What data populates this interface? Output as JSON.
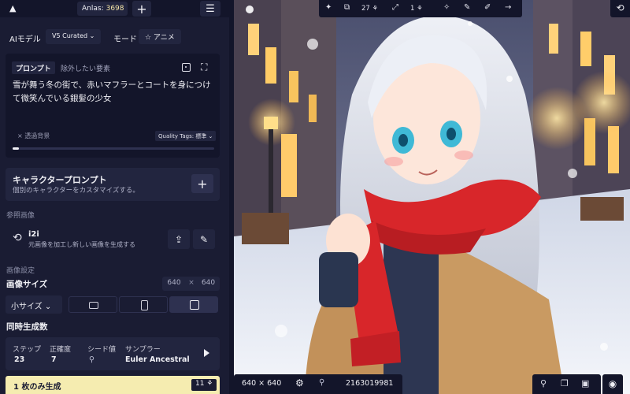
{
  "header": {
    "anlas_label": "Anlas:",
    "anlas_value": "3698",
    "plus_glyph": "+",
    "menu_glyph": "☰",
    "logo_glyph": "▲"
  },
  "model": {
    "label": "AIモデル",
    "value": "V5 Curated ⌄",
    "mode_label": "モード",
    "mode_value": "☆ アニメ"
  },
  "prompt": {
    "tab_prompt": "プロンプト",
    "tab_negative": "除外したい要素",
    "text": "雪が舞う冬の街で、赤いマフラーとコートを身につけて微笑んでいる銀髪の少女",
    "tag_suggestion": "× 透過背景",
    "quality_tags": "Quality Tags: 標準 ⌄",
    "expand_glyph": "⛶",
    "progress": 0.03
  },
  "character": {
    "title": "キャラクタープロンプト",
    "description": "個別のキャラクターをカスタマイズする。",
    "add_glyph": "+"
  },
  "reference": {
    "section_label": "参照画像",
    "i2i_title": "i2i",
    "i2i_description": "元画像を加工し新しい画像を生成する",
    "i2i_glyph": "⟲",
    "upload_glyph": "⇪",
    "edit_glyph": "✎"
  },
  "image_settings": {
    "section_label": "画像設定",
    "size_label": "画像サイズ",
    "width": "640",
    "height": "640",
    "times_glyph": "×",
    "size_preset": "小サイズ ⌄",
    "selected_shape": "square"
  },
  "batch": {
    "label": "同時生成数"
  },
  "params": {
    "steps_label": "ステップ",
    "steps_value": "23",
    "guidance_label": "正確度",
    "guidance_value": "7",
    "seed_label": "シード値",
    "seed_icon": "⚲",
    "sampler_label": "サンプラー",
    "sampler_value": "Euler Ancestral"
  },
  "generate": {
    "label": "1 枚のみ生成",
    "cost": "11 ⚘"
  },
  "toolbar": {
    "enhance": "✦",
    "variations": "⧉",
    "batch_count": "27 ⚘",
    "upscale": "⤢",
    "upscale_count": "1 ⚘",
    "magic": "✧",
    "paint": "✎",
    "director": "✐",
    "next": "→",
    "history": "⟲"
  },
  "image_info": {
    "size": "640 × 640",
    "gear": "⚙",
    "seed_icon": "⚲",
    "seed": "2163019981"
  },
  "image_actions": {
    "pin": "⚲",
    "copy": "❐",
    "save": "▣",
    "palette": "◉"
  },
  "colors": {
    "panel": "#1a1c33",
    "surface": "#22253f",
    "accent": "#f5ecb0",
    "background": "#13152a"
  }
}
